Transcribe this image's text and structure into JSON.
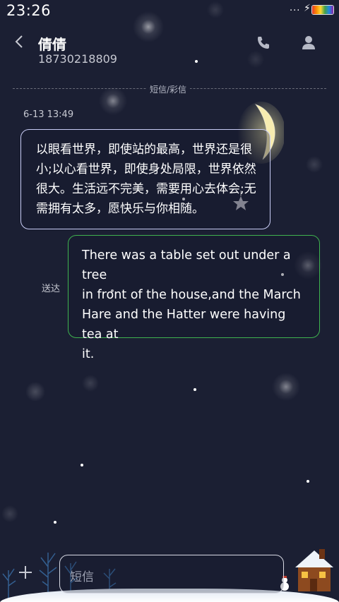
{
  "status_bar": {
    "time": "23:26",
    "more": "...",
    "charging": "⚡"
  },
  "header": {
    "contact_name": "倩倩",
    "contact_number": "18730218809"
  },
  "divider_label": "短信/彩信",
  "messages": [
    {
      "direction": "incoming",
      "timestamp": "6-13 13:49",
      "lines": [
        "以眼看世界，即使站的最高，世界还是很",
        "小;以心看世界，即使身处局限，世界依然",
        "很大。生活远不完美，需要用心去体会;无",
        "需拥有太多，愿快乐与你相随。"
      ]
    },
    {
      "direction": "outgoing",
      "status": "送达",
      "lines": [
        "There was a table set out under a tree",
        "in front of the house,and the March",
        "Hare and the Hatter were having tea at",
        "it."
      ]
    }
  ],
  "compose": {
    "placeholder": "短信"
  },
  "colors": {
    "background": "#1b1f33",
    "incoming_border": "#c8ccf5",
    "outgoing_border": "#3fb34f"
  },
  "icons": [
    "back-icon",
    "phone-icon",
    "person-icon",
    "plus-icon",
    "battery-icon"
  ]
}
